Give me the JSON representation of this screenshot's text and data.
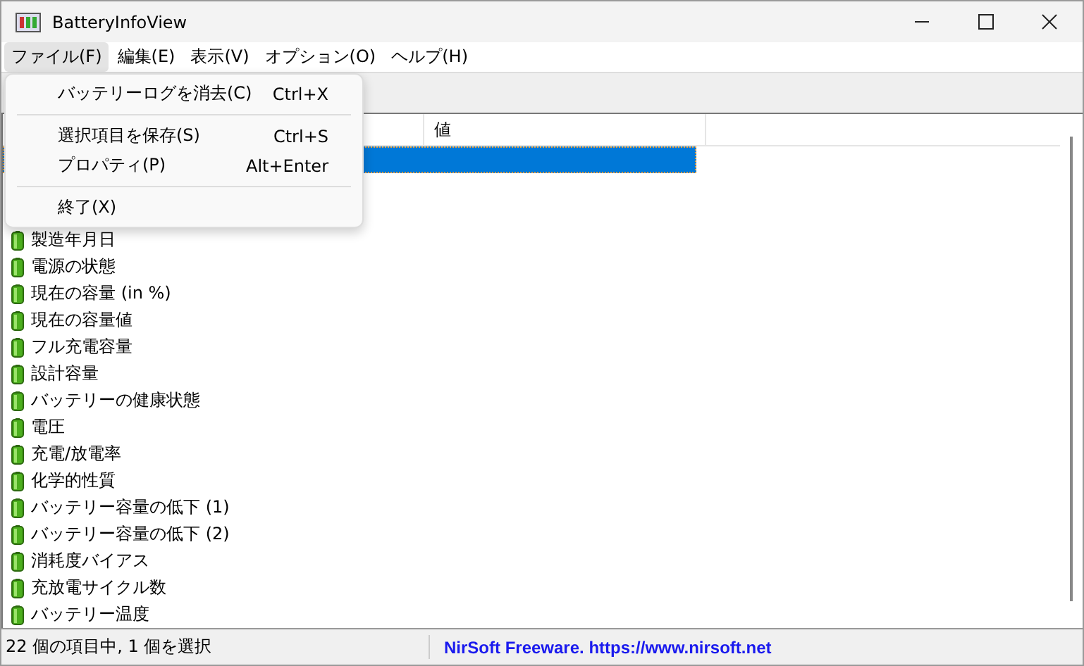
{
  "window": {
    "title": "BatteryInfoView"
  },
  "menu_bar": [
    {
      "label": "ファイル(F)",
      "selected": true
    },
    {
      "label": "編集(E)",
      "selected": false
    },
    {
      "label": "表示(V)",
      "selected": false
    },
    {
      "label": "オプション(O)",
      "selected": false
    },
    {
      "label": "ヘルプ(H)",
      "selected": false
    }
  ],
  "file_menu": [
    {
      "kind": "item",
      "label": "バッテリーログを消去(C)",
      "shortcut": "Ctrl+X"
    },
    {
      "kind": "separator"
    },
    {
      "kind": "item",
      "label": "選択項目を保存(S)",
      "shortcut": "Ctrl+S"
    },
    {
      "kind": "item",
      "label": "プロパティ(P)",
      "shortcut": "Alt+Enter"
    },
    {
      "kind": "separator"
    },
    {
      "kind": "item",
      "label": "終了(X)"
    }
  ],
  "table": {
    "column_2": "値",
    "rows": [
      {
        "selected": true
      },
      {
        "name": "製造年月日",
        "selected": false
      },
      {
        "name": "電源の状態",
        "selected": false
      },
      {
        "name": "現在の容量 (in %)",
        "selected": false
      },
      {
        "name": "現在の容量値",
        "selected": false
      },
      {
        "name": "フル充電容量",
        "selected": false
      },
      {
        "name": "設計容量",
        "selected": false
      },
      {
        "name": "バッテリーの健康状態",
        "selected": false
      },
      {
        "name": "電圧",
        "selected": false
      },
      {
        "name": "充電/放電率",
        "selected": false
      },
      {
        "name": "化学的性質",
        "selected": false
      },
      {
        "name": "バッテリー容量の低下 (1)",
        "selected": false
      },
      {
        "name": "バッテリー容量の低下 (2)",
        "selected": false
      },
      {
        "name": "消耗度バイアス",
        "selected": false
      },
      {
        "name": "充放電サイクル数",
        "selected": false
      },
      {
        "name": "バッテリー温度",
        "selected": false
      }
    ]
  },
  "status_bar": {
    "count": "22 個の項目中, 1 個を選択",
    "link": "NirSoft Freeware. https://www.nirsoft.net"
  }
}
